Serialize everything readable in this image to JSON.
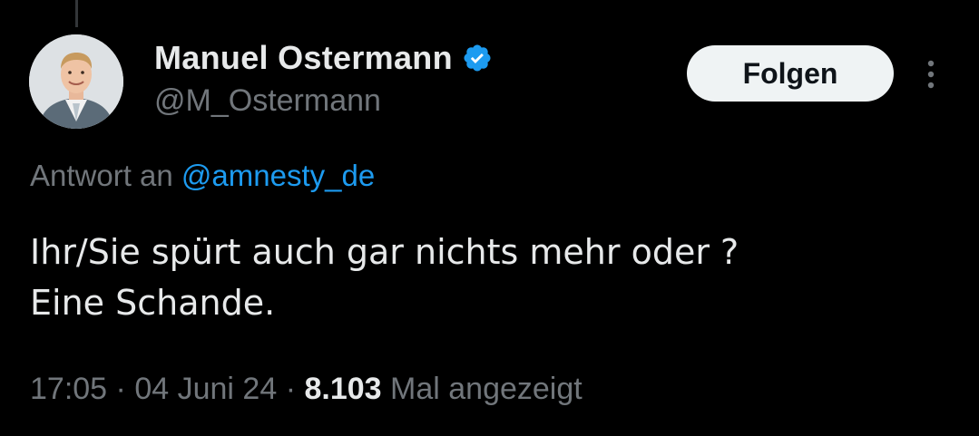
{
  "author": {
    "display_name": "Manuel Ostermann",
    "handle": "@M_Ostermann",
    "verified": true
  },
  "follow_button_label": "Folgen",
  "reply": {
    "prefix": "Antwort an",
    "mention": "@amnesty_de"
  },
  "tweet": {
    "lines": [
      "Ihr/Sie spürt auch gar nichts mehr oder ?",
      "Eine Schande."
    ]
  },
  "meta": {
    "time": "17:05",
    "separator": "·",
    "date": "04 Juni 24",
    "views_count": "8.103",
    "views_label": "Mal angezeigt"
  },
  "colors": {
    "background": "#000000",
    "primary_text": "#e7e9ea",
    "secondary_text": "#71767b",
    "link": "#1d9bf0",
    "verified": "#1d9bf0",
    "follow_bg": "#eff3f4"
  },
  "icons": {
    "verified": "verified-badge-icon",
    "more": "more-vertical-icon",
    "avatar": "profile-photo"
  }
}
